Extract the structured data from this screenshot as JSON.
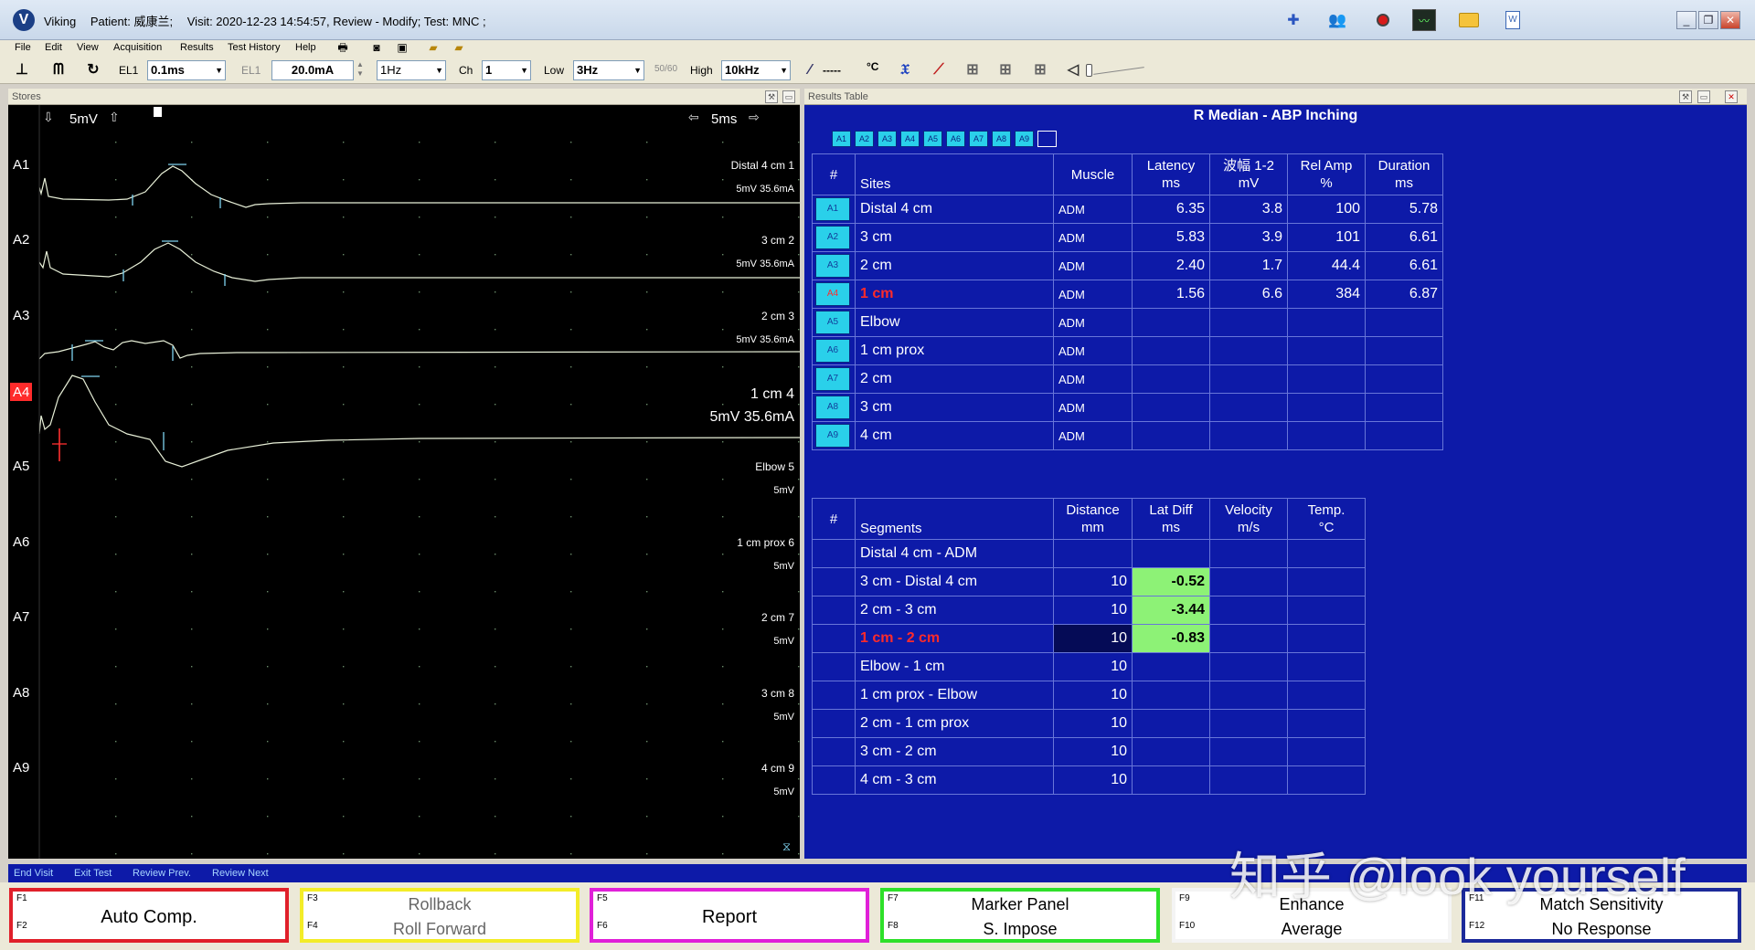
{
  "titlebar": {
    "app_name": "Viking",
    "patient": "Patient: 威康兰;",
    "visit": "Visit: 2020-12-23 14:54:57, Review - Modify; Test: MNC ;"
  },
  "menu": [
    "File",
    "Edit",
    "View",
    "Acquisition",
    "Results",
    "Test History",
    "Help"
  ],
  "toolbar": {
    "el1_label": "EL1",
    "timebase": "0.1ms",
    "el1_label_2": "EL1",
    "current": "20.0mA",
    "rate": "1Hz",
    "ch_label": "Ch",
    "channel": "1",
    "low_label": "Low",
    "low": "3Hz",
    "notch": "50/60",
    "high_label": "High",
    "high": "10kHz",
    "temp_value": "-----",
    "temp_unit": "°C"
  },
  "stores_panel": {
    "header": "Stores",
    "sensitivity": "5mV",
    "sweep": "5ms",
    "traces": [
      {
        "id": "A1",
        "label": "Distal 4 cm  1",
        "settings": "5mV 35.6mA",
        "active": false
      },
      {
        "id": "A2",
        "label": "3 cm  2",
        "settings": "5mV 35.6mA",
        "active": false
      },
      {
        "id": "A3",
        "label": "2 cm  3",
        "settings": "5mV 35.6mA",
        "active": false
      },
      {
        "id": "A4",
        "label": "1 cm  4",
        "settings": "5mV 35.6mA",
        "active": true
      },
      {
        "id": "A5",
        "label": "Elbow  5",
        "settings": "5mV",
        "active": false
      },
      {
        "id": "A6",
        "label": "1 cm prox  6",
        "settings": "5mV",
        "active": false
      },
      {
        "id": "A7",
        "label": "2 cm  7",
        "settings": "5mV",
        "active": false
      },
      {
        "id": "A8",
        "label": "3 cm  8",
        "settings": "5mV",
        "active": false
      },
      {
        "id": "A9",
        "label": "4 cm  9",
        "settings": "5mV",
        "active": false
      }
    ]
  },
  "results": {
    "header": "Results Table",
    "title": "R Median - ABP Inching",
    "chips": [
      "A1",
      "A2",
      "A3",
      "A4",
      "A5",
      "A6",
      "A7",
      "A8",
      "A9"
    ],
    "sites_table": {
      "headers": {
        "num": "#",
        "sites": "Sites",
        "muscle": "Muscle",
        "latency": "Latency\nms",
        "amp": "波幅 1-2\nmV",
        "relamp": "Rel Amp\n%",
        "duration": "Duration\nms"
      },
      "rows": [
        {
          "id": "A1",
          "site": "Distal 4 cm",
          "muscle": "ADM",
          "latency": "6.35",
          "amp": "3.8",
          "relamp": "100",
          "duration": "5.78"
        },
        {
          "id": "A2",
          "site": "3 cm",
          "muscle": "ADM",
          "latency": "5.83",
          "amp": "3.9",
          "relamp": "101",
          "duration": "6.61"
        },
        {
          "id": "A3",
          "site": "2 cm",
          "muscle": "ADM",
          "latency": "2.40",
          "amp": "1.7",
          "relamp": "44.4",
          "duration": "6.61"
        },
        {
          "id": "A4",
          "site": "1 cm",
          "muscle": "ADM",
          "latency": "1.56",
          "amp": "6.6",
          "relamp": "384",
          "duration": "6.87",
          "selected": true
        },
        {
          "id": "A5",
          "site": "Elbow",
          "muscle": "ADM",
          "latency": "",
          "amp": "",
          "relamp": "",
          "duration": ""
        },
        {
          "id": "A6",
          "site": "1 cm prox",
          "muscle": "ADM",
          "latency": "",
          "amp": "",
          "relamp": "",
          "duration": ""
        },
        {
          "id": "A7",
          "site": "2 cm",
          "muscle": "ADM",
          "latency": "",
          "amp": "",
          "relamp": "",
          "duration": ""
        },
        {
          "id": "A8",
          "site": "3 cm",
          "muscle": "ADM",
          "latency": "",
          "amp": "",
          "relamp": "",
          "duration": ""
        },
        {
          "id": "A9",
          "site": "4 cm",
          "muscle": "ADM",
          "latency": "",
          "amp": "",
          "relamp": "",
          "duration": ""
        }
      ]
    },
    "segments_table": {
      "headers": {
        "num": "#",
        "segments": "Segments",
        "distance": "Distance\nmm",
        "latdiff": "Lat Diff\nms",
        "velocity": "Velocity\nm/s",
        "temp": "Temp.\n°C"
      },
      "rows": [
        {
          "segment": "Distal 4 cm - ADM",
          "distance": "",
          "latdiff": "",
          "velocity": "",
          "temp": ""
        },
        {
          "segment": "3 cm - Distal 4 cm",
          "distance": "10",
          "latdiff": "-0.52",
          "velocity": "",
          "temp": ""
        },
        {
          "segment": "2 cm - 3 cm",
          "distance": "10",
          "latdiff": "-3.44",
          "velocity": "",
          "temp": ""
        },
        {
          "segment": "1 cm - 2 cm",
          "distance": "10",
          "latdiff": "-0.83",
          "velocity": "",
          "temp": "",
          "selected": true
        },
        {
          "segment": "Elbow - 1 cm",
          "distance": "10",
          "latdiff": "",
          "velocity": "",
          "temp": ""
        },
        {
          "segment": "1 cm prox - Elbow",
          "distance": "10",
          "latdiff": "",
          "velocity": "",
          "temp": ""
        },
        {
          "segment": "2 cm - 1 cm prox",
          "distance": "10",
          "latdiff": "",
          "velocity": "",
          "temp": ""
        },
        {
          "segment": "3 cm - 2 cm",
          "distance": "10",
          "latdiff": "",
          "velocity": "",
          "temp": ""
        },
        {
          "segment": "4 cm - 3 cm",
          "distance": "10",
          "latdiff": "",
          "velocity": "",
          "temp": ""
        }
      ]
    }
  },
  "nav": {
    "end_visit": "End Visit",
    "exit_test": "Exit Test",
    "review_prev": "Review Prev.",
    "review_next": "Review Next"
  },
  "fkeys": [
    {
      "k1": "F1",
      "k2": "F2",
      "center": "Auto Comp.",
      "color": "#e0202a"
    },
    {
      "k1": "F3",
      "k2": "F4",
      "l1": "Rollback",
      "l2": "Roll Forward",
      "color": "#f3ec28",
      "grey": true
    },
    {
      "k1": "F5",
      "k2": "F6",
      "center": "Report",
      "color": "#e020d8"
    },
    {
      "k1": "F7",
      "k2": "F8",
      "l1": "Marker Panel",
      "l2": "S. Impose",
      "color": "#2ee02a"
    },
    {
      "k1": "F9",
      "k2": "F10",
      "l1": "Enhance",
      "l2": "Average",
      "color": "#f4f4f4"
    },
    {
      "k1": "F11",
      "k2": "F12",
      "l1": "Match Sensitivity",
      "l2": "No Response",
      "color": "#1c2a9a"
    }
  ],
  "watermark": "知乎 @look yourself",
  "colors": {
    "results_bg": "#0d1aa8",
    "trace": "#e8f0d8",
    "highlight": "#8df276",
    "selected_text": "#ff2b2b",
    "active_trace_tag": "#ff2b2b"
  }
}
